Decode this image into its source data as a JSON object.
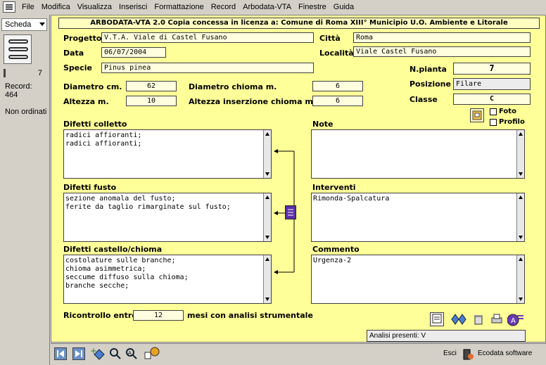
{
  "menubar": {
    "items": [
      "File",
      "Modifica",
      "Visualizza",
      "Inserisci",
      "Formattazione",
      "Record",
      "Arbodata-VTA",
      "Finestre",
      "Guida"
    ]
  },
  "leftpane": {
    "layout": "Scheda",
    "record_count": "7",
    "record_label": "Record:",
    "record_total": "464",
    "sort_status": "Non ordinati"
  },
  "form": {
    "header": "ARBODATA-VTA 2.0 Copia concessa in licenza a: Comune di Roma XIII° Municipio U.O. Ambiente e Litorale",
    "progetto": {
      "label": "Progetto",
      "value": "V.T.A. Viale di Castel Fusano"
    },
    "citta": {
      "label": "Città",
      "value": "Roma"
    },
    "data": {
      "label": "Data",
      "value": "06/07/2004"
    },
    "localita": {
      "label": "Località",
      "value": "Viale Castel Fusano"
    },
    "specie": {
      "label": "Specie",
      "value": "Pinus pinea"
    },
    "npianta": {
      "label": "N.pianta",
      "value": "7"
    },
    "posizione": {
      "label": "Posizione",
      "value": "Filare"
    },
    "classe": {
      "label": "Classe",
      "value": "C"
    },
    "diametro": {
      "label": "Diametro cm.",
      "value": "62"
    },
    "altezza": {
      "label": "Altezza m.",
      "value": "10"
    },
    "diametro_chioma": {
      "label": "Diametro chioma m.",
      "value": "6"
    },
    "altezza_ins": {
      "label": "Altezza inserzione chioma m.",
      "value": "6"
    },
    "foto": {
      "label": "Foto"
    },
    "profilo": {
      "label": "Profilo"
    },
    "difetti_colletto": {
      "label": "Difetti colletto",
      "lines": [
        "radici affioranti;",
        "radici affioranti;"
      ]
    },
    "difetti_fusto": {
      "label": "Difetti fusto",
      "lines": [
        "sezione anomala del fusto;",
        "ferite da taglio rimarginate sul fusto;"
      ]
    },
    "difetti_castello": {
      "label": "Difetti castello/chioma",
      "lines": [
        "costolature sulle branche;",
        "chioma asimmetrica;",
        "seccume diffuso sulla chioma;",
        "branche secche;"
      ]
    },
    "note": {
      "label": "Note",
      "lines": []
    },
    "interventi": {
      "label": "Interventi",
      "lines": [
        "Rimonda-Spalcatura"
      ]
    },
    "commento": {
      "label": "Commento",
      "lines": [
        "Urgenza-2"
      ]
    },
    "ricontrollo": {
      "label_pre": "Ricontrollo entro",
      "value": "12",
      "label_post": "mesi con analisi strumentale"
    },
    "analisi": "Analisi presenti: V"
  },
  "bottombar": {
    "esci": "Esci",
    "brand": "Ecodata software"
  }
}
